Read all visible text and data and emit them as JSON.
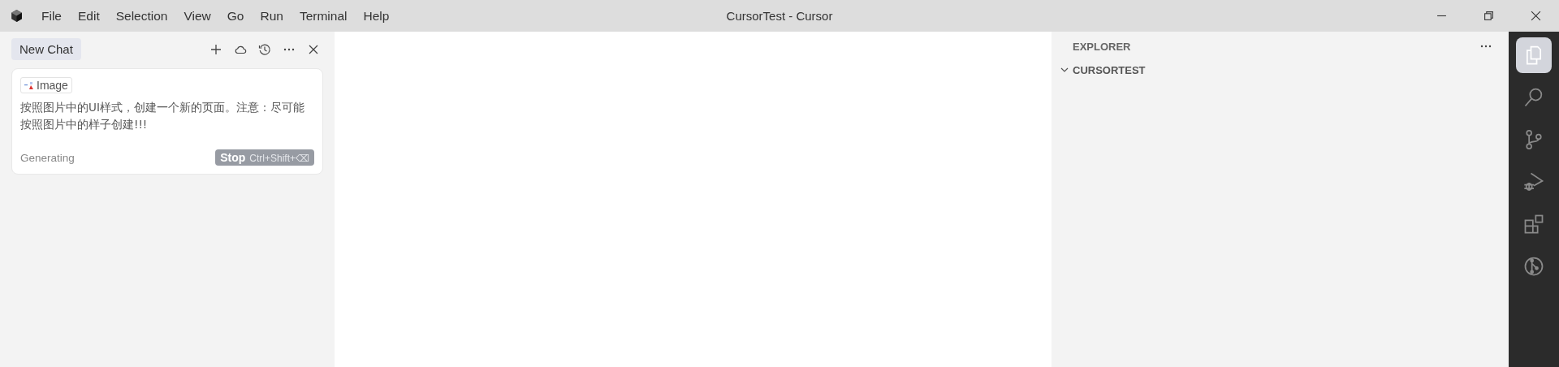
{
  "window": {
    "title": "CursorTest - Cursor"
  },
  "menu": [
    "File",
    "Edit",
    "Selection",
    "View",
    "Go",
    "Run",
    "Terminal",
    "Help"
  ],
  "chat": {
    "tab": {
      "label": "New Chat",
      "selected": true
    },
    "message": {
      "attachment": "Image",
      "text": "按照图片中的UI样式，创建一个新的页面。注意：尽可能按照图片中的样子创建!!!",
      "status": "Generating",
      "stop_button": {
        "label": "Stop",
        "shortcut": "Ctrl+Shift+⌫"
      }
    }
  },
  "explorer": {
    "title": "EXPLORER",
    "folder": {
      "name": "CURSORTEST",
      "expanded": true
    }
  },
  "activity_bar": [
    {
      "kind": "files",
      "selected": true
    },
    {
      "kind": "search",
      "selected": false
    },
    {
      "kind": "git",
      "selected": false
    },
    {
      "kind": "debug",
      "selected": false
    },
    {
      "kind": "extensions",
      "selected": false
    },
    {
      "kind": "remote",
      "selected": false
    }
  ]
}
